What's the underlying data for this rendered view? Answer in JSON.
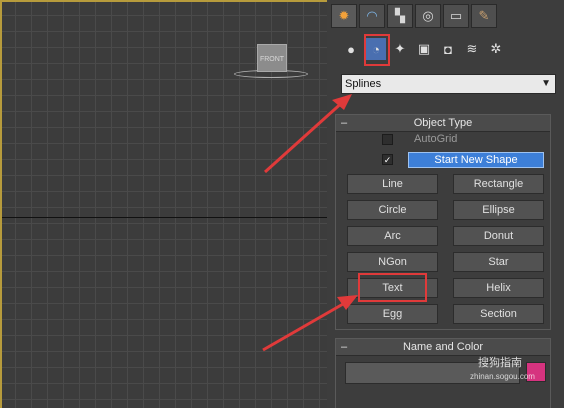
{
  "viewport": {
    "view_label": "FRONT"
  },
  "command_panel": {
    "tabs": [
      {
        "icon": "create-icon"
      },
      {
        "icon": "modify-icon"
      },
      {
        "icon": "hierarchy-icon"
      },
      {
        "icon": "motion-icon"
      },
      {
        "icon": "display-icon"
      },
      {
        "icon": "utilities-icon"
      }
    ],
    "category_icons": [
      {
        "icon": "geometry-icon"
      },
      {
        "icon": "shapes-icon",
        "active": true
      },
      {
        "icon": "lights-icon"
      },
      {
        "icon": "cameras-icon"
      },
      {
        "icon": "helpers-icon"
      },
      {
        "icon": "space-warps-icon"
      },
      {
        "icon": "systems-icon"
      }
    ],
    "dropdown_value": "Splines",
    "object_type": {
      "title": "Object Type",
      "autogrid_label": "AutoGrid",
      "start_new_shape_label": "Start New Shape",
      "buttons": [
        "Line",
        "Rectangle",
        "Circle",
        "Ellipse",
        "Arc",
        "Donut",
        "NGon",
        "Star",
        "Text",
        "Helix",
        "Egg",
        "Section"
      ]
    },
    "name_and_color": {
      "title": "Name and Color",
      "color": "#d6337f"
    }
  },
  "annotations": {
    "highlight_color": "#e03a3a"
  },
  "watermark": {
    "text": "搜狗指南",
    "url": "zhinan.sogou.com"
  }
}
